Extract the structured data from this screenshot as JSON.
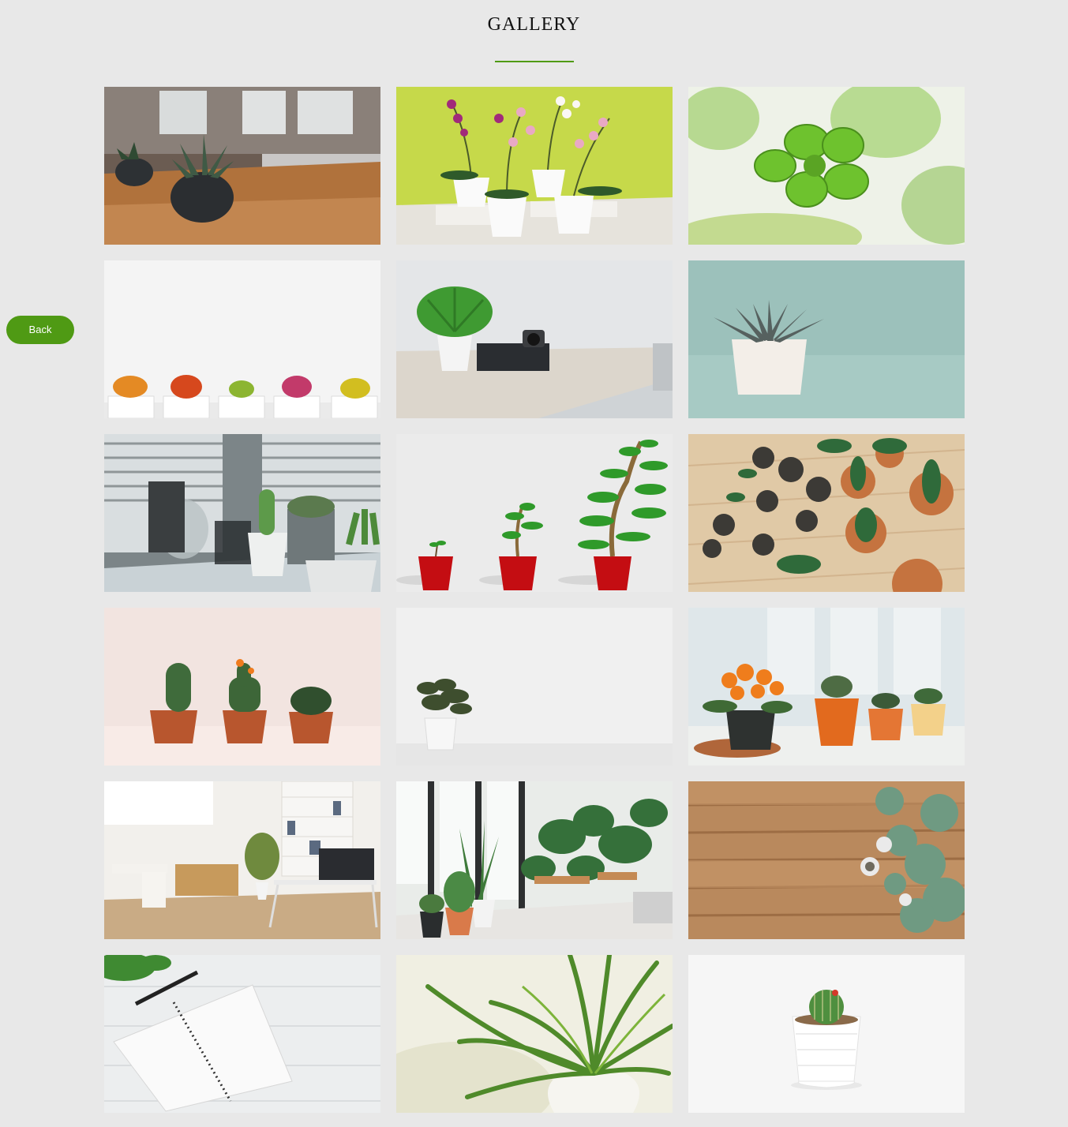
{
  "page": {
    "title": "GALLERY"
  },
  "nav": {
    "back_label": "Back"
  },
  "gallery": {
    "items": [
      {
        "subject": "succulent-dark-pot-on-wood-table",
        "bg": "#b07a4a"
      },
      {
        "subject": "orchids-white-pots-lime-wall",
        "bg": "#c6d94a"
      },
      {
        "subject": "green-leaf-macro",
        "bg": "#eef2e8"
      },
      {
        "subject": "five-flowering-cacti-row",
        "bg": "#f4f4f4"
      },
      {
        "subject": "fern-desk-camera-laptop",
        "bg": "#e4e6e8"
      },
      {
        "subject": "aloe-white-pot-teal",
        "bg": "#9cc1bb"
      },
      {
        "subject": "cacti-terrariums-window-blinds",
        "bg": "#7c8588"
      },
      {
        "subject": "growing-sapling-three-red-pots",
        "bg": "#ebebeb"
      },
      {
        "subject": "potted-plants-top-view-floor",
        "bg": "#e0c9a6"
      },
      {
        "subject": "three-cacti-terracotta-pink",
        "bg": "#f2e4e0"
      },
      {
        "subject": "small-plant-white-room",
        "bg": "#f0f0f0"
      },
      {
        "subject": "flowering-plants-windowsill",
        "bg": "#dfe7ea"
      },
      {
        "subject": "white-home-office-shelves",
        "bg": "#f2f0ec"
      },
      {
        "subject": "indoor-jungle-room",
        "bg": "#e9ece9"
      },
      {
        "subject": "succulents-wood-planks",
        "bg": "#b9895d"
      },
      {
        "subject": "notebook-pen-white-wood",
        "bg": "#eceeef"
      },
      {
        "subject": "spider-plant-white-vase",
        "bg": "#f0efe2"
      },
      {
        "subject": "cactus-white-pot",
        "bg": "#f6f6f6"
      }
    ]
  },
  "colors": {
    "accent": "#4f9a14",
    "background": "#e8e8e8"
  }
}
